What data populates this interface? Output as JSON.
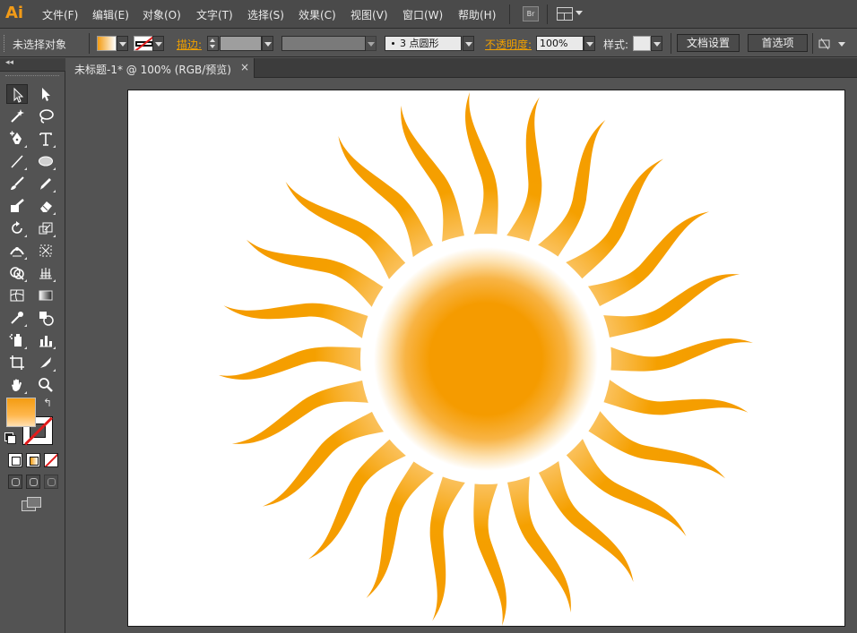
{
  "app": {
    "logo": "Ai"
  },
  "menu": [
    "文件(F)",
    "编辑(E)",
    "对象(O)",
    "文字(T)",
    "选择(S)",
    "效果(C)",
    "视图(V)",
    "窗口(W)",
    "帮助(H)"
  ],
  "bridge_button": "Br",
  "control_bar": {
    "selection_status": "未选择对象",
    "stroke_label": "描边:",
    "brush_value": "3 点圆形",
    "opacity_label": "不透明度:",
    "opacity_value": "100%",
    "style_label": "样式:",
    "doc_setup_button": "文档设置",
    "preferences_button": "首选项"
  },
  "document": {
    "tab_title": "未标题-1* @ 100% (RGB/预览)",
    "tab_close": "×"
  },
  "toolbox": {
    "collapse_glyph": "◂◂",
    "swap_glyph": "↰"
  },
  "colors": {
    "accent": "#f29b17",
    "sun_core": "#f59b00",
    "ray": "#f5a000",
    "canvas_bg": "#535353",
    "artboard": "#ffffff"
  },
  "artwork": {
    "ray_count": 24
  }
}
